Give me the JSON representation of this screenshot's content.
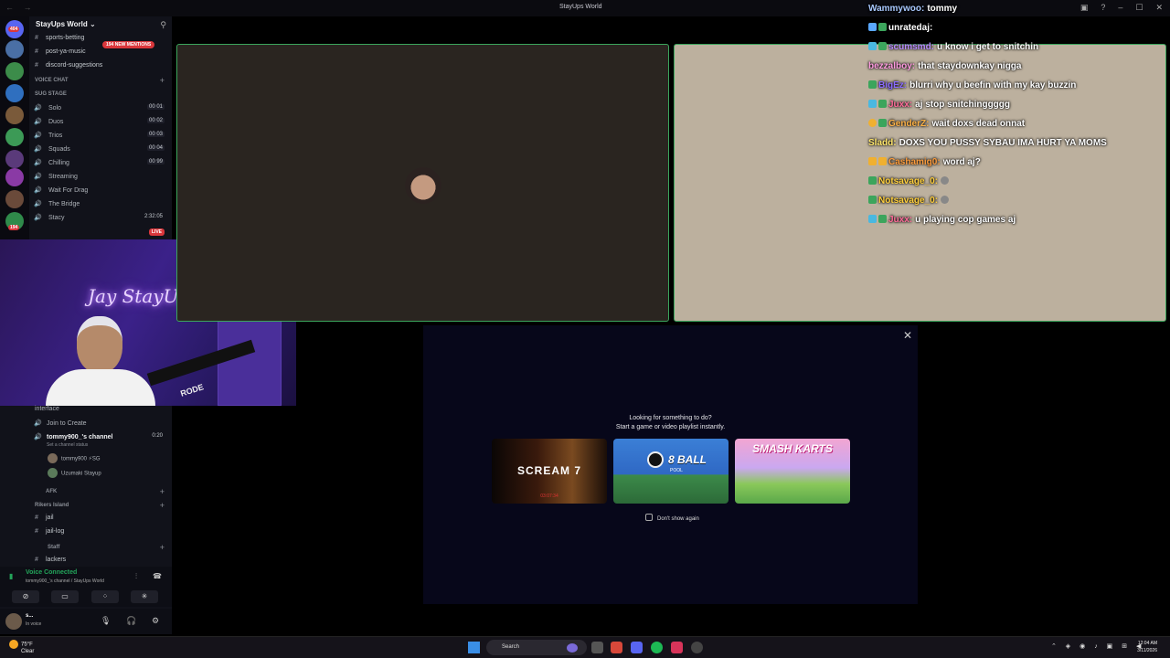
{
  "window": {
    "title": "StayUps World",
    "controls": [
      "–",
      "☐",
      "✕"
    ]
  },
  "server": {
    "name": "StayUps World ⌄",
    "mentions_pill": "194 NEW MENTIONS",
    "rail_badges": [
      "404",
      "194"
    ]
  },
  "channels_top": [
    {
      "label": "sports-betting"
    },
    {
      "label": "post-ya-music"
    },
    {
      "label": "discord-suggestions"
    }
  ],
  "voice_chat_category": "VOICE CHAT",
  "sug_stage": "SUG STAGE",
  "voice_channels": [
    {
      "label": "Solo",
      "count": "00 01"
    },
    {
      "label": "Duos",
      "count": "00 02"
    },
    {
      "label": "Trios",
      "count": "00 03"
    },
    {
      "label": "Squads",
      "count": "00 04"
    },
    {
      "label": "Chilling",
      "count": "00 99"
    },
    {
      "label": "Streaming",
      "count": ""
    },
    {
      "label": "Wait For Drag",
      "count": ""
    },
    {
      "label": "The Bridge",
      "count": ""
    },
    {
      "label": "Stacy",
      "count": "2:32:05"
    }
  ],
  "live_badge": "LIVE",
  "lower_channels": {
    "interface": "interface",
    "join_to_create": "Join to Create",
    "active_channel": "tommy900_'s channel",
    "active_time": "0:20",
    "channel_status": "Set a channel status",
    "members": [
      "tommy900 ⚡SG",
      "Uzumaki Stayup"
    ],
    "afk_category": "AFK",
    "rikers_category": "Rikers Island",
    "jail": "jail",
    "jail_log": "jail-log",
    "staff_category": "Staff",
    "lackers": "lackers"
  },
  "webcam": {
    "neon_text": "Jay StayUp",
    "mic_brand": "RODE"
  },
  "chat": [
    {
      "user": "Wammywoo:",
      "text": "tommy",
      "color": "#a9c9ff"
    },
    {
      "user": "unratedaj:",
      "text": "",
      "color": "#ffffff"
    },
    {
      "user": "scumsmd:",
      "text": "u know i get to snitchin",
      "color": "#b68cff"
    },
    {
      "user": "bezzalboy:",
      "text": "that staydownkay nigga",
      "color": "#ff9be0"
    },
    {
      "user": "BigEz:",
      "text": "blurri why u beefin with my kay buzzin",
      "color": "#8a6bff"
    },
    {
      "user": "Juxx:",
      "text": "aj stop snitchinggggg",
      "color": "#ff6b9a"
    },
    {
      "user": "GenderZ:",
      "text": "wait doxs dead onnat",
      "color": "#ffb347"
    },
    {
      "user": "Sladd:",
      "text": "DOXS YOU PUSSY SYBAU IMA HURT YA MOMS",
      "color": "#ffe66b"
    },
    {
      "user": "Cashamig0:",
      "text": "word aj?",
      "color": "#ff9d3c"
    },
    {
      "user": "Notsavage_0:",
      "text": "",
      "color": "#ffcf3c"
    },
    {
      "user": "Notsavage_0:",
      "text": "",
      "color": "#ffcf3c"
    },
    {
      "user": "Juxx:",
      "text": "u playing cop games aj",
      "color": "#ff6b9a"
    }
  ],
  "activity": {
    "line1": "Looking for something to do?",
    "line2": "Start a game or video playlist instantly.",
    "games": [
      {
        "title": "SCREAM 7",
        "sub": "03:07:34"
      },
      {
        "title": "8 BALL",
        "sub": "POOL"
      },
      {
        "title": "SMASH KARTS",
        "sub": ""
      }
    ],
    "dont_show": "Don't show again",
    "close": "✕"
  },
  "voice_panel": {
    "state": "Voice Connected",
    "sub": "tommy900_'s channel / StayUps World"
  },
  "user_panel": {
    "name": "s...",
    "status": "In voice"
  },
  "taskbar": {
    "temp": "75°F",
    "weather": "Clear",
    "search": "Search",
    "time": "12:04 AM",
    "date": "3/11/2026"
  }
}
